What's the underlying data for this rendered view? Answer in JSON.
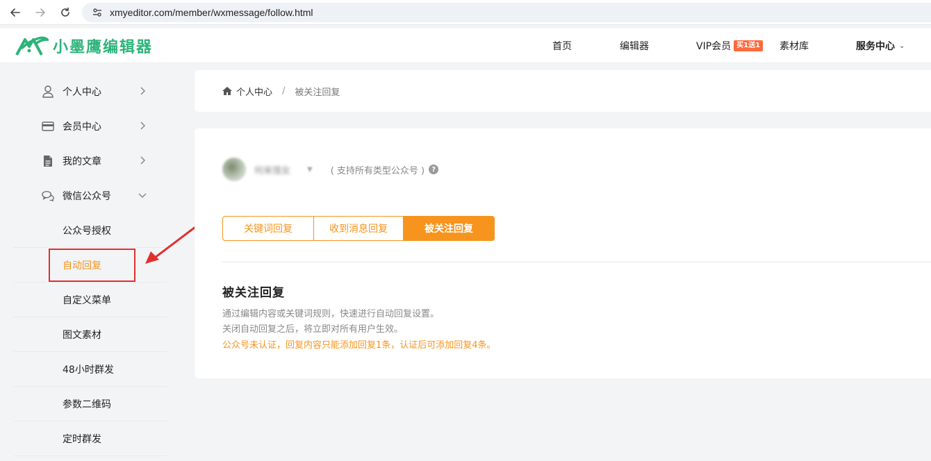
{
  "browser": {
    "url": "xmyeditor.com/member/wxmessage/follow.html"
  },
  "header": {
    "logo_text": "小墨鹰编辑器",
    "nav": {
      "home": "首页",
      "editor": "编辑器",
      "vip": "VIP会员",
      "vip_badge": "买1送1",
      "materials": "素材库",
      "service": "服务中心"
    }
  },
  "sidebar": {
    "items": [
      {
        "label": "个人中心",
        "icon": "user-icon"
      },
      {
        "label": "会员中心",
        "icon": "card-icon"
      },
      {
        "label": "我的文章",
        "icon": "document-icon"
      },
      {
        "label": "微信公众号",
        "icon": "chat-icon"
      }
    ],
    "subitems": [
      {
        "label": "公众号授权"
      },
      {
        "label": "自动回复"
      },
      {
        "label": "自定义菜单"
      },
      {
        "label": "图文素材"
      },
      {
        "label": "48小时群发"
      },
      {
        "label": "参数二维码"
      },
      {
        "label": "定时群发"
      }
    ],
    "active": "自动回复"
  },
  "breadcrumb": {
    "home": "个人中心",
    "separator": "/",
    "current": "被关注回复"
  },
  "main": {
    "account_name": "何来馆女",
    "support_text": "( 支持所有类型公众号 )",
    "tabs": [
      {
        "label": "关键词回复"
      },
      {
        "label": "收到消息回复"
      },
      {
        "label": "被关注回复"
      }
    ],
    "active_tab": "被关注回复",
    "section_title": "被关注回复",
    "desc1": "通过编辑内容或关键词规则，快速进行自动回复设置。",
    "desc2": "关闭自动回复之后，将立即对所有用户生效。",
    "warning": "公众号未认证，回复内容只能添加回复1条，认证后可添加回复4条。"
  },
  "colors": {
    "brand_green": "#2db37a",
    "accent_orange": "#f7941d",
    "annotation_red": "#e0302e"
  }
}
